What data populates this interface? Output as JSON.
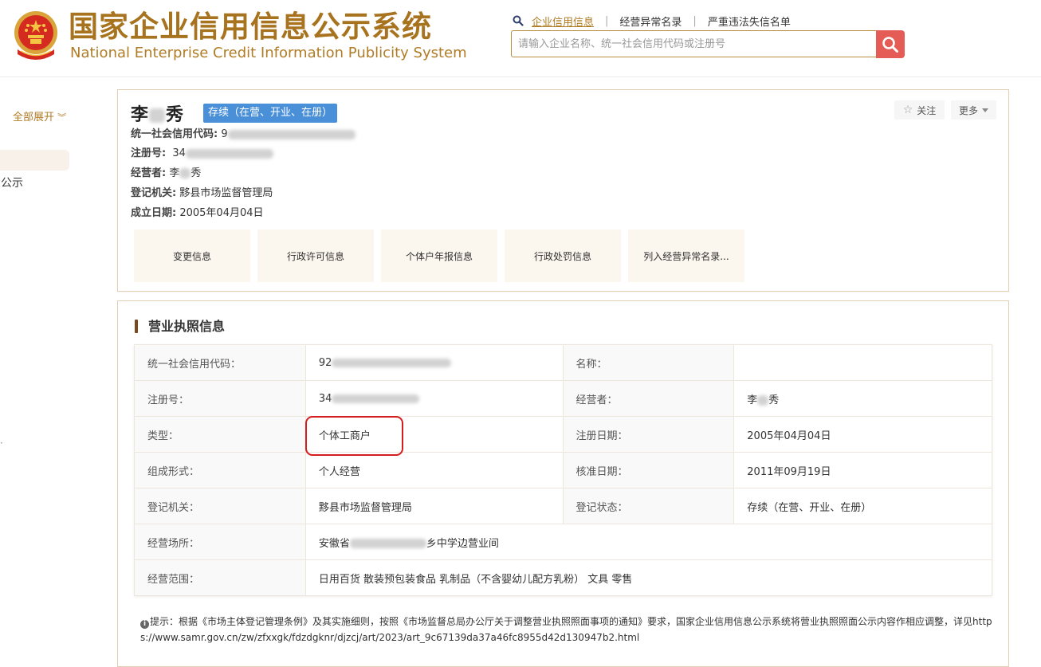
{
  "header": {
    "title_cn": "国家企业信用信息公示系统",
    "title_en": "National Enterprise Credit Information Publicity System",
    "nav": [
      "企业信用信息",
      "经营异常名录",
      "严重违法失信名单"
    ],
    "search_placeholder": "请输入企业名称、统一社会信用代码或注册号",
    "accent_color": "#b07c25",
    "search_button_color": "#e45c55"
  },
  "sidebar": {
    "expand_all": "全部展开",
    "item_partial": "息公示"
  },
  "company": {
    "name_first": "李",
    "name_last": "秀",
    "status_tag": "存续（在营、开业、在册）",
    "status_tag_color": "#4a90d9",
    "follow_label": "关注",
    "more_label": "更多",
    "info": [
      {
        "label": "统一社会信用代码:",
        "value": "9"
      },
      {
        "label": "注册号:",
        "value": "34"
      },
      {
        "label": "经营者:",
        "value": "李",
        "value_tail": "秀"
      },
      {
        "label": "登记机关:",
        "value": "黟县市场监督管理局"
      },
      {
        "label": "成立日期:",
        "value": "2005年04月04日"
      }
    ],
    "quick_links": [
      "变更信息",
      "行政许可信息",
      "个体户年报信息",
      "行政处罚信息",
      "列入经营异常名录..."
    ]
  },
  "license": {
    "section_title": "营业执照信息",
    "rows": [
      {
        "k1": "统一社会信用代码：",
        "v1": "92",
        "k2": "名称：",
        "v2": ""
      },
      {
        "k1": "注册号：",
        "v1": "34",
        "k2": "经营者：",
        "v2": "李",
        "v2_tail": "秀"
      },
      {
        "k1": "类型：",
        "v1": "个体工商户",
        "k2": "注册日期：",
        "v2": "2005年04月04日"
      },
      {
        "k1": "组成形式：",
        "v1": "个人经营",
        "k2": "核准日期：",
        "v2": "2011年09月19日"
      },
      {
        "k1": "登记机关：",
        "v1": "黟县市场监督管理局",
        "k2": "登记状态：",
        "v2": "存续（在营、开业、在册）"
      }
    ],
    "address_label": "经营场所：",
    "address_prefix": "安徽省",
    "address_suffix": "乡中学边营业间",
    "scope_label": "经营范围：",
    "scope_value": "日用百货 散装预包装食品 乳制品（不含婴幼儿配方乳粉） 文具 零售",
    "highlight_color": "#d51d1d"
  },
  "notice": {
    "text": "提示：根据《市场主体登记管理条例》及其实施细则，按照《市场监督总局办公厅关于调整营业执照照面事项的通知》要求，国家企业信用信息公示系统将营业执照照面公示内容作相应调整，详见https://www.samr.gov.cn/zw/zfxxgk/fdzdgknr/djzcj/art/2023/art_9c67139da37a46fc8955d42d130947b2.html"
  }
}
